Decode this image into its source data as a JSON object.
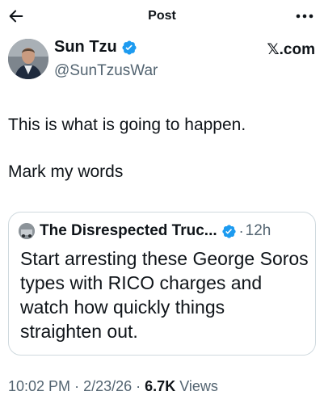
{
  "header": {
    "title": "Post",
    "back_icon": "arrow-left-icon",
    "more_icon": "more-horizontal-icon"
  },
  "author": {
    "name": "Sun Tzu",
    "handle": "@SunTzusWar",
    "verified_icon": "verified-badge-icon",
    "brand": "𝕏.com"
  },
  "tweet": {
    "lines": [
      "This is what is going to happen.",
      "Mark my words"
    ]
  },
  "quote": {
    "name": "The Disrespected Truc...",
    "separator": "·",
    "time": "12h",
    "verified_icon": "verified-badge-icon",
    "text": "Start arresting these George Soros types with RICO charges and watch how quickly things straighten out."
  },
  "meta": {
    "time": "10:02 PM",
    "separator": "·",
    "date": "2/23/26",
    "views_count": "6.7K",
    "views_label": "Views"
  },
  "colors": {
    "text": "#0f1419",
    "secondary": "#536471",
    "verified": "#1d9bf0",
    "border": "#cfd9de"
  }
}
